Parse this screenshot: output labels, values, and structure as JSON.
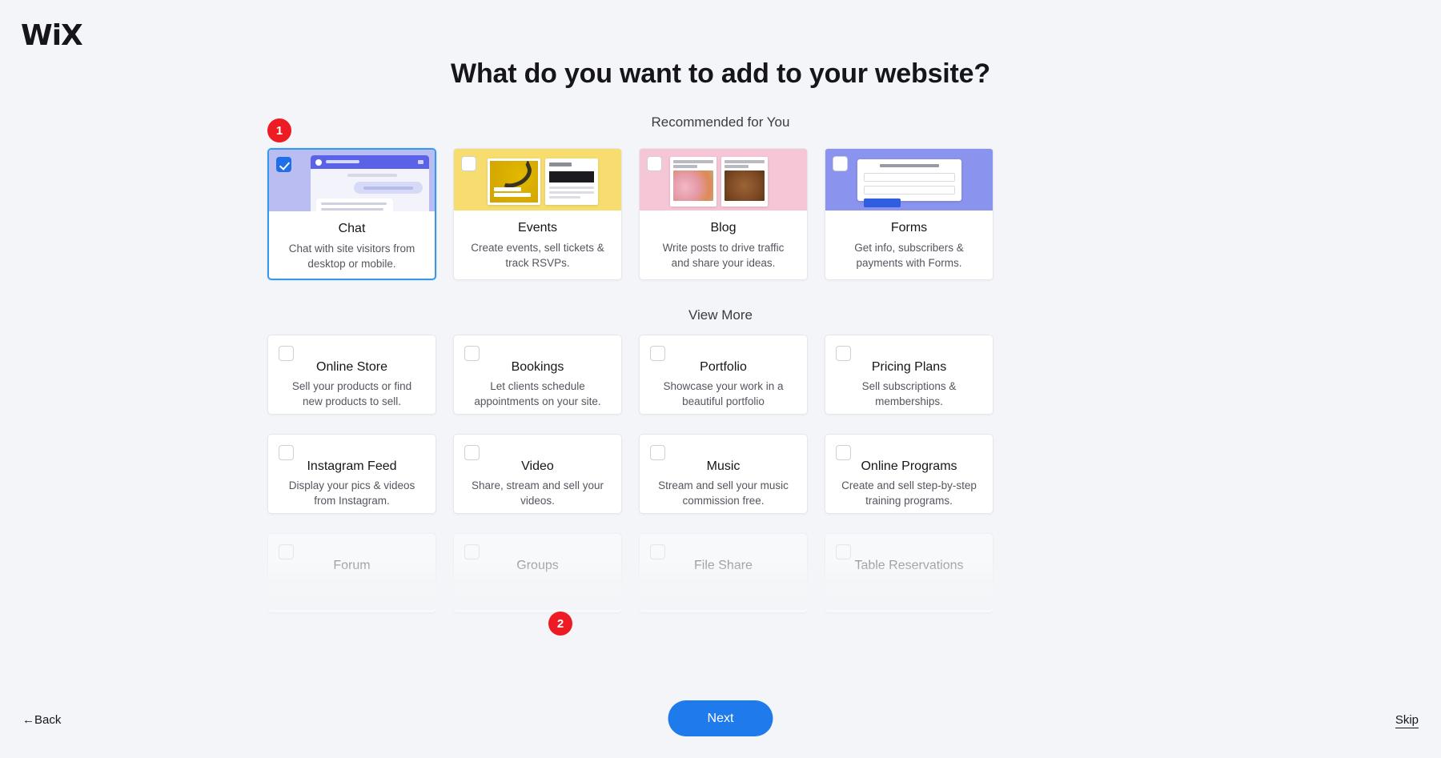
{
  "brand": {
    "logo_text": "WiX"
  },
  "header": {
    "title": "What do you want to add to your website?"
  },
  "sections": {
    "recommended_label": "Recommended for You",
    "view_more_label": "View More"
  },
  "recommended_cards": [
    {
      "title": "Chat",
      "desc_line1": "Chat with site visitors from",
      "desc_line2": "desktop or mobile.",
      "selected": true,
      "thumb": "chat-thumbnail",
      "thumb_color": "#b9bdf2"
    },
    {
      "title": "Events",
      "desc_line1": "Create events, sell tickets &",
      "desc_line2": "track RSVPs.",
      "selected": false,
      "thumb": "events-thumbnail",
      "thumb_color": "#f7dd6f"
    },
    {
      "title": "Blog",
      "desc_line1": "Write posts to drive traffic",
      "desc_line2": "and share your ideas.",
      "selected": false,
      "thumb": "blog-thumbnail",
      "thumb_color": "#f5c6d6"
    },
    {
      "title": "Forms",
      "desc_line1": "Get info, subscribers &",
      "desc_line2": "payments with Forms.",
      "selected": false,
      "thumb": "forms-thumbnail",
      "thumb_color": "#8a93ee"
    }
  ],
  "more_cards": [
    {
      "title": "Online Store",
      "desc_line1": "Sell your products or find",
      "desc_line2": "new products to sell.",
      "faded": false
    },
    {
      "title": "Bookings",
      "desc_line1": "Let clients schedule",
      "desc_line2": "appointments on your site.",
      "faded": false
    },
    {
      "title": "Portfolio",
      "desc_line1": "Showcase your work in a",
      "desc_line2": "beautiful portfolio",
      "faded": false
    },
    {
      "title": "Pricing Plans",
      "desc_line1": "Sell subscriptions &",
      "desc_line2": "memberships.",
      "faded": false
    },
    {
      "title": "Instagram Feed",
      "desc_line1": "Display your pics & videos",
      "desc_line2": "from Instagram.",
      "faded": false
    },
    {
      "title": "Video",
      "desc_line1": "Share, stream and sell your",
      "desc_line2": "videos.",
      "faded": false
    },
    {
      "title": "Music",
      "desc_line1": "Stream and sell your music",
      "desc_line2": "commission free.",
      "faded": false
    },
    {
      "title": "Online Programs",
      "desc_line1": "Create and sell step-by-step",
      "desc_line2": "training programs.",
      "faded": false
    },
    {
      "title": "Forum",
      "desc_line1": "",
      "desc_line2": "",
      "faded": true
    },
    {
      "title": "Groups",
      "desc_line1": "",
      "desc_line2": "",
      "faded": true
    },
    {
      "title": "File Share",
      "desc_line1": "",
      "desc_line2": "",
      "faded": true
    },
    {
      "title": "Table Reservations",
      "desc_line1": "",
      "desc_line2": "",
      "faded": true
    }
  ],
  "annotations": [
    {
      "number": "1",
      "target": "chat-card"
    },
    {
      "number": "2",
      "target": "next-button"
    }
  ],
  "footer": {
    "back_label": "←Back",
    "next_label": "Next",
    "skip_label": "Skip"
  },
  "colors": {
    "accent_blue": "#1f7aec",
    "selected_border": "#3899ec",
    "badge_red": "#ed1c24",
    "page_background": "#f4f5f8"
  }
}
